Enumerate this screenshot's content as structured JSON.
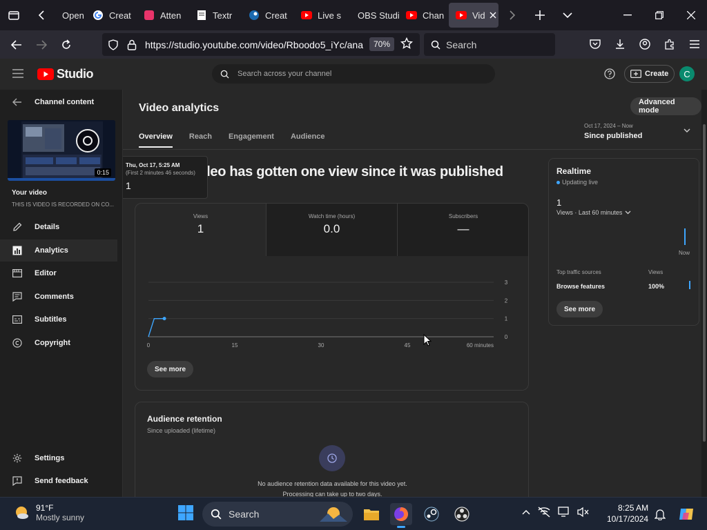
{
  "browser": {
    "tabs": [
      {
        "label": "Open",
        "icon": "firefox-view-icon"
      },
      {
        "label": "Creat",
        "icon": "google-icon"
      },
      {
        "label": "Atten",
        "icon": "app-icon"
      },
      {
        "label": "Textr",
        "icon": "document-icon"
      },
      {
        "label": "Creat",
        "icon": "steam-icon"
      },
      {
        "label": "Live s",
        "icon": "youtube-icon"
      },
      {
        "label": "OBS Studi",
        "icon": "none"
      },
      {
        "label": "Chan",
        "icon": "youtube-icon"
      },
      {
        "label": "Vid",
        "icon": "youtube-icon"
      }
    ],
    "url": "https://studio.youtube.com/video/Rboodo5_iYc/ana",
    "zoom": "70%",
    "search_placeholder": "Search"
  },
  "header": {
    "logo_text": "Studio",
    "search_placeholder": "Search across your channel",
    "create_label": "Create",
    "avatar_letter": "C"
  },
  "sidebar": {
    "back_label": "Channel content",
    "duration": "0:15",
    "your_video_label": "Your video",
    "video_title": "THIS IS VIDEO IS RECORDED ON CO...",
    "items": [
      {
        "label": "Details",
        "icon": "pencil-icon"
      },
      {
        "label": "Analytics",
        "icon": "analytics-icon"
      },
      {
        "label": "Editor",
        "icon": "editor-icon"
      },
      {
        "label": "Comments",
        "icon": "comments-icon"
      },
      {
        "label": "Subtitles",
        "icon": "subtitles-icon"
      },
      {
        "label": "Copyright",
        "icon": "copyright-icon"
      }
    ],
    "bottom_items": [
      {
        "label": "Settings",
        "icon": "gear-icon"
      },
      {
        "label": "Send feedback",
        "icon": "feedback-icon"
      }
    ]
  },
  "main": {
    "title": "Video analytics",
    "advanced_mode": "Advanced mode",
    "tabs": [
      "Overview",
      "Reach",
      "Engagement",
      "Audience"
    ],
    "date_range_small": "Oct 17, 2024 – Now",
    "date_range": "Since published",
    "headline": "This video has gotten one view since it was published",
    "metrics": [
      {
        "label": "Views",
        "value": "1"
      },
      {
        "label": "Watch time (hours)",
        "value": "0.0"
      },
      {
        "label": "Subscribers",
        "value": "—"
      }
    ],
    "see_more": "See more",
    "tooltip": {
      "date": "Thu, Oct 17, 5:25 AM",
      "sub": "(First 2 minutes 46 seconds)",
      "value": "1"
    },
    "retention": {
      "title": "Audience retention",
      "subtitle": "Since uploaded (lifetime)",
      "msg1": "No audience retention data available for this video yet.",
      "msg2": "Processing can take up to two days."
    }
  },
  "realtime": {
    "title": "Realtime",
    "status": "Updating live",
    "value": "1",
    "metric_label": "Views · Last 60 minutes",
    "now_label": "Now",
    "sources_header": "Top traffic sources",
    "views_header": "Views",
    "source": "Browse features",
    "source_pct": "100%",
    "see_more": "See more"
  },
  "chart_data": {
    "type": "line",
    "x_ticks": [
      "0",
      "15",
      "30",
      "45",
      "60 minutes"
    ],
    "y_ticks": [
      "3",
      "2",
      "1",
      "0"
    ],
    "ylim": [
      0,
      3
    ],
    "xlim": [
      0,
      60
    ],
    "series": [
      {
        "values": [
          [
            0,
            0
          ],
          [
            1,
            1
          ],
          [
            2.77,
            1
          ]
        ]
      }
    ],
    "color": "#3ea6ff"
  },
  "taskbar": {
    "temp": "91°F",
    "weather": "Mostly sunny",
    "search": "Search",
    "time": "8:25 AM",
    "date": "10/17/2024"
  },
  "colors": {
    "accent": "#3ea6ff",
    "youtube_red": "#ff0000",
    "avatar": "#0a8a6e"
  }
}
